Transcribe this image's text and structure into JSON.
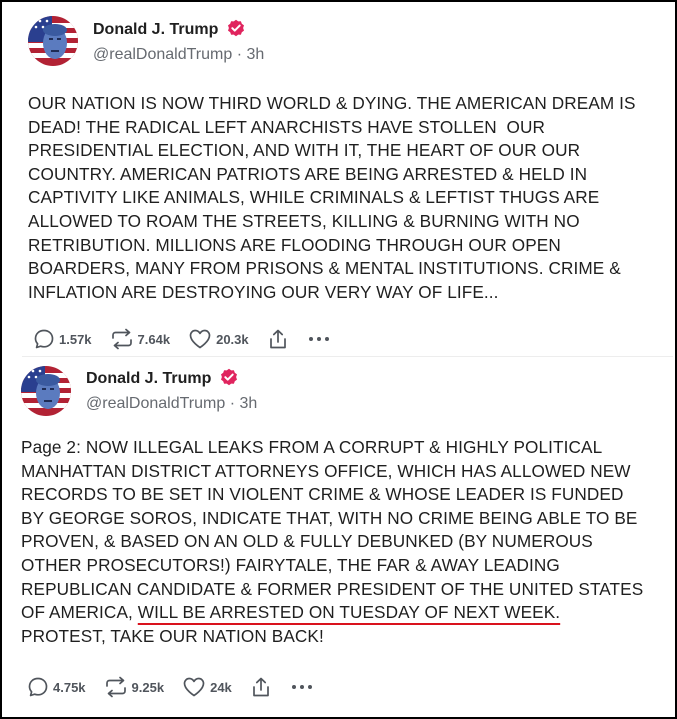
{
  "posts": [
    {
      "author": {
        "name": "Donald J. Trump",
        "handle": "@realDonaldTrump",
        "time": "3h",
        "avatar_icon": "avatar-flag-portrait",
        "verified_color": "#e0245e"
      },
      "lines": [
        "OUR NATION IS NOW THIRD WORLD & DYING. THE AMERICAN DREAM IS",
        "DEAD! THE RADICAL LEFT ANARCHISTS HAVE STOLLEN  OUR",
        "PRESIDENTIAL ELECTION, AND WITH IT, THE HEART OF OUR OUR",
        "COUNTRY. AMERICAN PATRIOTS ARE BEING ARRESTED & HELD IN",
        "CAPTIVITY LIKE ANIMALS, WHILE CRIMINALS & LEFTIST THUGS ARE",
        "ALLOWED TO ROAM THE STREETS, KILLING & BURNING WITH NO",
        "RETRIBUTION. MILLIONS ARE FLOODING THROUGH OUR OPEN",
        "BOARDERS, MANY FROM PRISONS & MENTAL INSTITUTIONS. CRIME &",
        "INFLATION ARE DESTROYING OUR VERY WAY OF LIFE..."
      ],
      "stats": {
        "replies": "1.57k",
        "retruths": "7.64k",
        "likes": "20.3k"
      }
    },
    {
      "author": {
        "name": "Donald J. Trump",
        "handle": "@realDonaldTrump",
        "time": "3h",
        "avatar_icon": "avatar-flag-portrait",
        "verified_color": "#e0245e"
      },
      "lines": [
        "Page 2: NOW ILLEGAL LEAKS FROM A CORRUPT & HIGHLY POLITICAL",
        "MANHATTAN DISTRICT ATTORNEYS OFFICE, WHICH HAS ALLOWED NEW",
        "RECORDS TO BE SET IN VIOLENT CRIME & WHOSE LEADER IS FUNDED",
        "BY GEORGE SOROS, INDICATE THAT, WITH NO CRIME BEING ABLE TO BE",
        "PROVEN, & BASED ON AN OLD & FULLY DEBUNKED (BY NUMEROUS",
        "OTHER PROSECUTORS!) FAIRYTALE, THE FAR & AWAY LEADING",
        "REPUBLICAN CANDIDATE & FORMER PRESIDENT OF THE UNITED STATES"
      ],
      "line8_prefix": "OF AMERICA, ",
      "line8_underlined": "WILL BE ARRESTED ON TUESDAY OF NEXT WEEK.",
      "line9": "PROTEST, TAKE OUR NATION BACK!",
      "underline_color": "#d9121d",
      "stats": {
        "replies": "4.75k",
        "retruths": "9.25k",
        "likes": "24k"
      }
    }
  ]
}
